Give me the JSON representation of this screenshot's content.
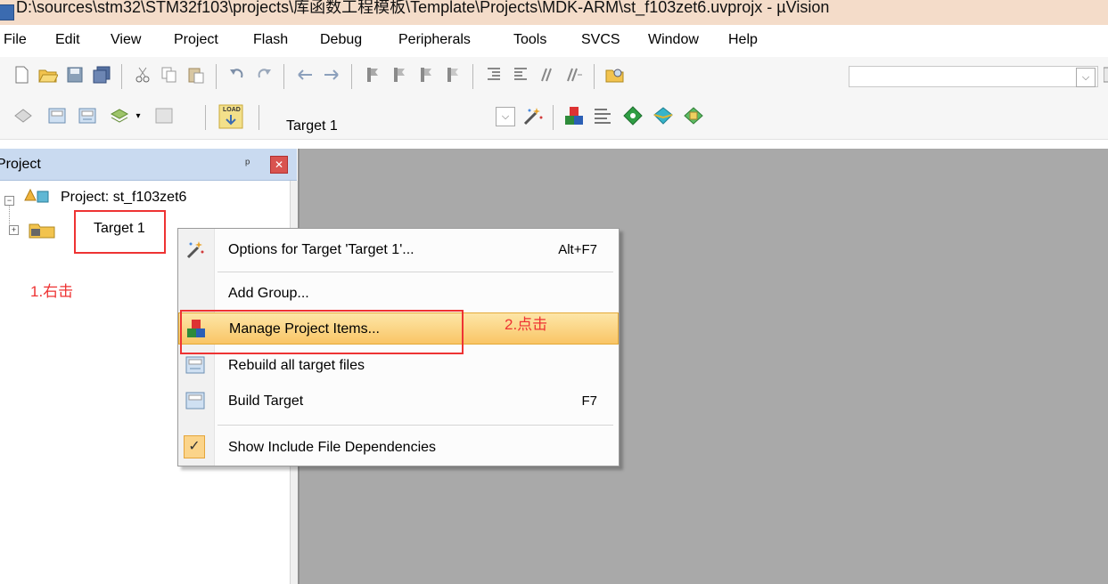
{
  "window": {
    "title": "D:\\sources\\stm32\\STM32f103\\projects\\库函数工程模板\\Template\\Projects\\MDK-ARM\\st_f103zet6.uvprojx - µVision"
  },
  "menu": [
    "File",
    "Edit",
    "View",
    "Project",
    "Flash",
    "Debug",
    "Peripherals",
    "Tools",
    "SVCS",
    "Window",
    "Help"
  ],
  "build_toolbar": {
    "load_label": "LOAD",
    "target_selected": "Target 1"
  },
  "project_panel": {
    "title": "Project",
    "pin_symbol": "ᵖ",
    "close_symbol": "✕",
    "root_label": "Project: st_f103zet6",
    "target_label": "Target 1"
  },
  "context_menu": {
    "items": [
      {
        "label": "Options for Target 'Target 1'...",
        "shortcut": "Alt+F7",
        "icon": "magic-wand-icon"
      },
      {
        "label": "Add Group...",
        "shortcut": "",
        "icon": ""
      },
      {
        "label": "Manage Project Items...",
        "shortcut": "",
        "icon": "project-items-icon",
        "highlighted": true
      },
      {
        "label": "Rebuild all target files",
        "shortcut": "",
        "icon": "rebuild-icon"
      },
      {
        "label": "Build Target",
        "shortcut": "F7",
        "icon": "build-icon"
      },
      {
        "label": "Show Include File Dependencies",
        "shortcut": "",
        "icon": "checkmark-icon",
        "checked": true
      }
    ]
  },
  "annotations": {
    "step1": "1.右击",
    "step2": "2.点击",
    "color": "#e33333"
  },
  "colors": {
    "title_bar": "#f4dcc9",
    "panel_header": "#c9daf0",
    "highlight": "#f9c565",
    "workspace": "#a9a9a9"
  }
}
